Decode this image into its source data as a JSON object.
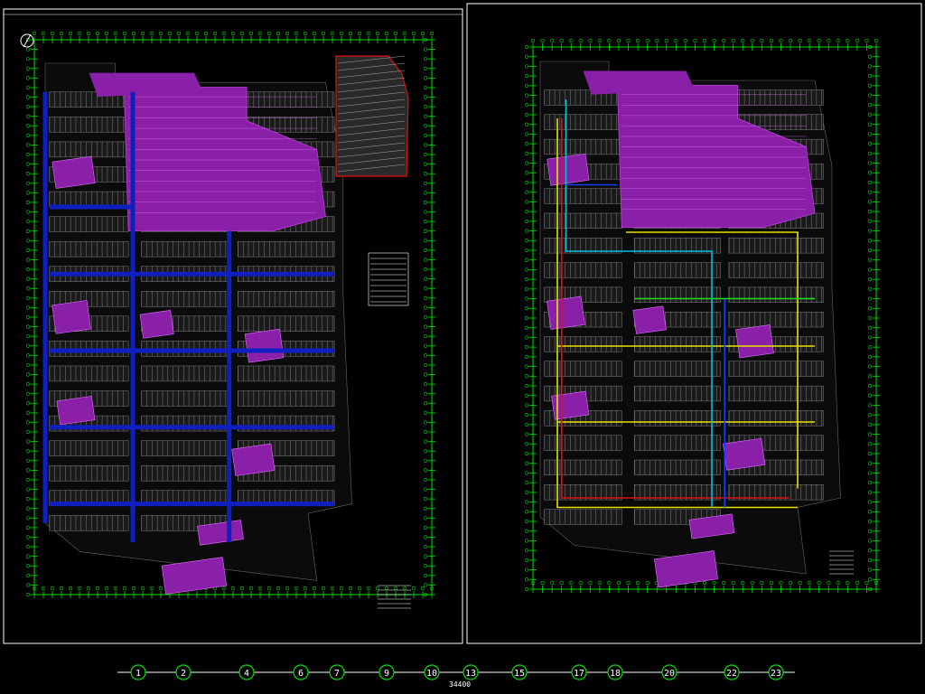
{
  "colors": {
    "background": "#000000",
    "frame": "#ffffff",
    "gridline": "#00e000",
    "parking_zone": "#8a1fa8",
    "parking_lane": "#1020c0",
    "pipe_yellow": "#e8e000",
    "pipe_red": "#e01010",
    "pipe_cyan": "#00c0e0",
    "pipe_blue": "#1040ff",
    "stall": "#9a9a9a"
  },
  "bottom_axis": {
    "labels": [
      "1",
      "2",
      "4",
      "6",
      "7",
      "9",
      "10",
      "13",
      "15",
      "17",
      "18",
      "20",
      "22",
      "23"
    ],
    "dimension": "34400"
  }
}
